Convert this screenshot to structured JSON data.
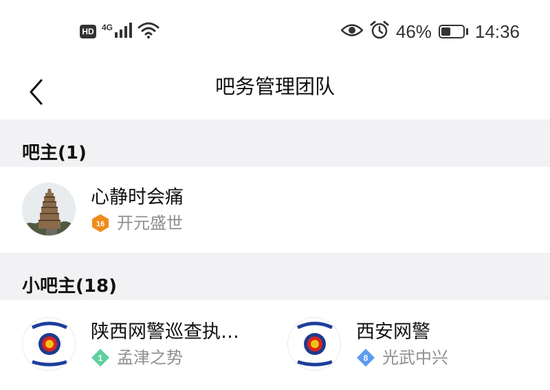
{
  "status_bar": {
    "hd": "HD",
    "network": "4G",
    "battery_percent": "46%",
    "battery_level": 0.46,
    "time": "14:36",
    "icons": [
      "hd-icon",
      "signal-icon",
      "wifi-icon",
      "eye-icon",
      "alarm-icon",
      "battery-icon"
    ]
  },
  "nav": {
    "title": "吧务管理团队",
    "back_icon": "chevron-left-icon"
  },
  "sections": [
    {
      "header": "吧主(1)",
      "members": [
        {
          "name": "心静时会痛",
          "level": "16",
          "title": "开元盛世",
          "badge_color": "#f08a1c",
          "avatar": "pagoda-avatar"
        }
      ]
    },
    {
      "header": "小吧主(18)",
      "members": [
        {
          "name": "陕西网警巡查执…",
          "level": "1",
          "title": "孟津之势",
          "badge_color": "#5fd0a0",
          "avatar": "police-emblem-avatar"
        },
        {
          "name": "西安网警",
          "level": "8",
          "title": "光武中兴",
          "badge_color": "#5b9cf0",
          "avatar": "police-emblem-avatar"
        }
      ]
    }
  ],
  "colors": {
    "section_bg": "#f2f2f4",
    "text_primary": "#111111",
    "text_secondary": "#8f8f8f"
  }
}
